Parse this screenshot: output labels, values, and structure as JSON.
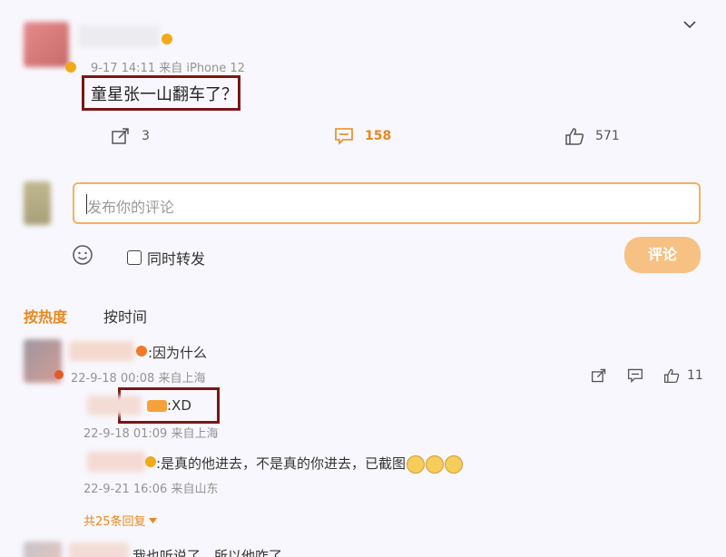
{
  "post": {
    "meta": "9-17 14:11 来自 iPhone 12",
    "text": "童星张一山翻车了？",
    "reposts": "3",
    "comments": "158",
    "likes": "571"
  },
  "composer": {
    "placeholder": "发布你的评论",
    "repost_label": "同时转发",
    "submit_label": "评论"
  },
  "sort_tabs": {
    "hot": "按热度",
    "time": "按时间"
  },
  "comments": [
    {
      "text": ":因为什么",
      "meta": "22-9-18 00:08 来自上海",
      "likes": "11",
      "replies": [
        {
          "text": ":XD",
          "meta": "22-9-18 01:09 来自上海"
        },
        {
          "text": ":是真的他进去，不是真的你进去，已截图",
          "meta": "22-9-21 16:06 来自山东"
        }
      ],
      "more_replies": "共25条回复"
    },
    {
      "text": "我也听说了，所以他咋了"
    }
  ],
  "colors": {
    "accent": "#e8881d",
    "input_border": "#f4b15c",
    "highlight_box": "#7a1616"
  }
}
